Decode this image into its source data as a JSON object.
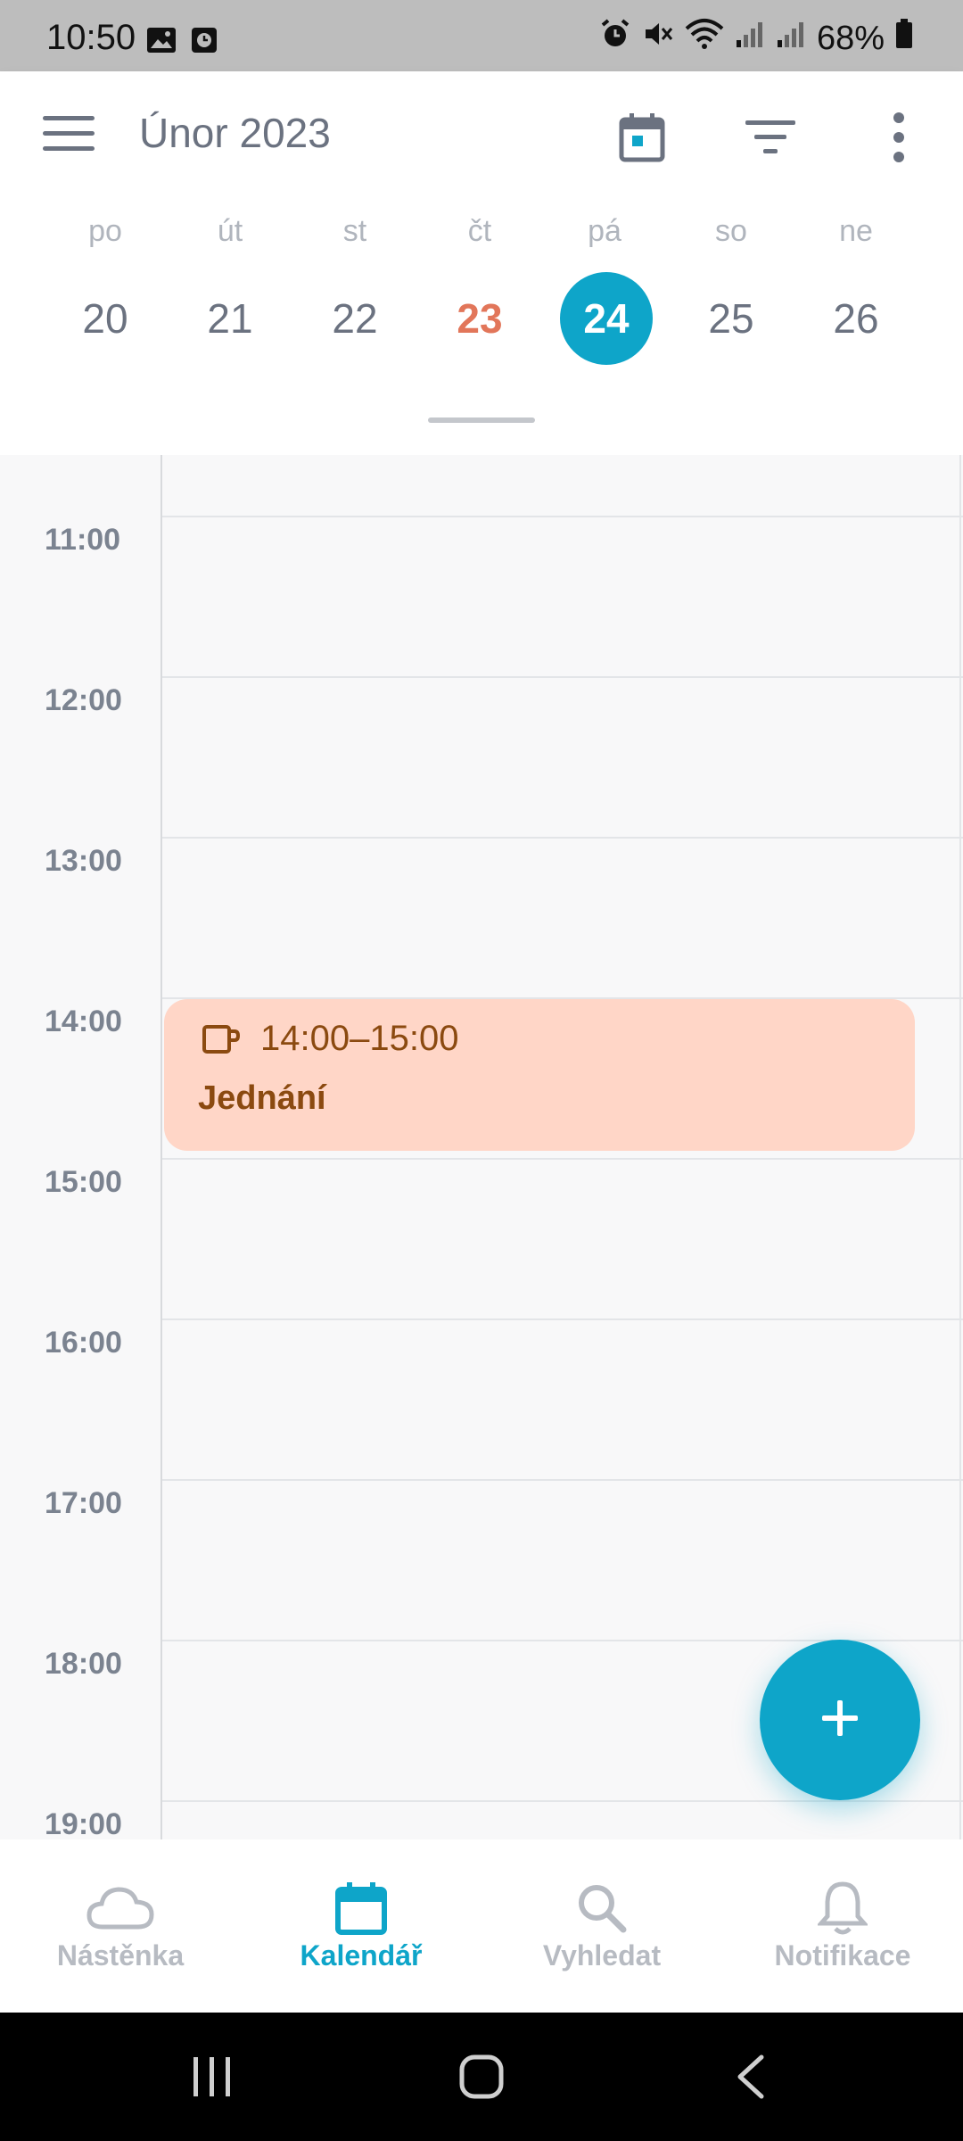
{
  "status_bar": {
    "time": "10:50",
    "battery": "68%"
  },
  "header": {
    "month": "Únor 2023",
    "actions": [
      "calendar-today-icon",
      "filter-icon",
      "more-vert-icon"
    ]
  },
  "week": {
    "days": [
      {
        "weekday": "po",
        "date": "20"
      },
      {
        "weekday": "út",
        "date": "21"
      },
      {
        "weekday": "st",
        "date": "22"
      },
      {
        "weekday": "čt",
        "date": "23"
      },
      {
        "weekday": "pá",
        "date": "24"
      },
      {
        "weekday": "so",
        "date": "25"
      },
      {
        "weekday": "ne",
        "date": "26"
      }
    ],
    "today_date": "23",
    "selected_date": "24"
  },
  "timeline": {
    "hours": [
      "11:00",
      "12:00",
      "13:00",
      "14:00",
      "15:00",
      "16:00",
      "17:00",
      "18:00",
      "19:00"
    ]
  },
  "event": {
    "time": "14:00–15:00",
    "title": "Jednání",
    "icon": "coffee-icon",
    "color": "#ffd6c7"
  },
  "fab": {
    "icon": "plus-icon"
  },
  "bottom_nav": {
    "items": [
      {
        "label": "Nástěnka",
        "icon": "cloud-icon"
      },
      {
        "label": "Kalendář",
        "icon": "calendar-icon"
      },
      {
        "label": "Vyhledat",
        "icon": "search-icon"
      },
      {
        "label": "Notifikace",
        "icon": "bell-icon"
      }
    ],
    "active": "Kalendář"
  },
  "colors": {
    "accent": "#0ea5c9",
    "today": "#e2765a",
    "event_text": "#8b4a10"
  }
}
